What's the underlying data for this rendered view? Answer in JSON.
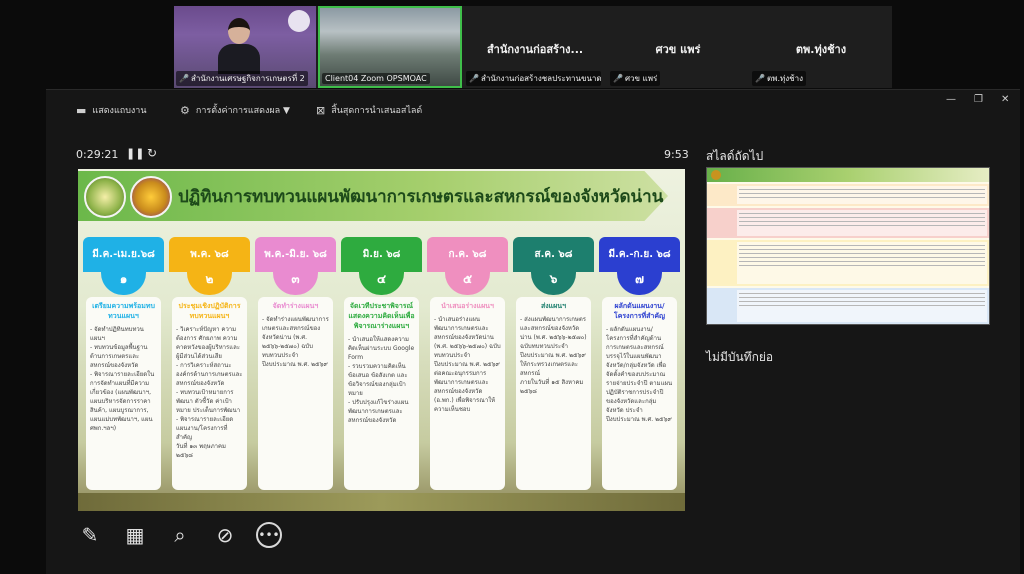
{
  "participants": [
    {
      "caption": "สำนักงานเศรษฐกิจการเกษตรที่ 2",
      "big_name": ""
    },
    {
      "caption": "Client04 Zoom OPSMOAC",
      "big_name": ""
    },
    {
      "caption": "สำนักงานก่อสร้างชลประทานขนาดกลา...",
      "big_name": "สำนักงานก่อสร้าง..."
    },
    {
      "caption": "ศวข แพร่",
      "big_name": "ศวข แพร่"
    },
    {
      "caption": "ตพ.ทุ่งช้าง",
      "big_name": "ตพ.ทุ่งช้าง"
    }
  ],
  "toolbar": {
    "show_taskbar": "แสดงแถบงาน",
    "display_settings": "การตั้งค่าการแสดงผล ▼",
    "end_slideshow": "สิ้นสุดการนำเสนอสไลด์"
  },
  "presenter": {
    "elapsed": "0:29:21",
    "clock": "9:53",
    "next_slide_label": "สไลด์ถัดไป",
    "notes_label": "ไม่มีบันทึกย่อ"
  },
  "slide": {
    "title": "ปฏิทินการทบทวนแผนพัฒนาการเกษตรและสหกรณ์ของจังหวัดน่าน",
    "steps": [
      {
        "period": "มี.ค.-เม.ย.๖๘",
        "num": "๑",
        "head_color": "#1fb1e6",
        "title": "เตรียมความพร้อมทบทวนแผนฯ",
        "body": "- จัดทำปฏิทินทบทวนแผนฯ\n- ทบทวนข้อมูลพื้นฐานด้านการเกษตรและสหกรณ์ของจังหวัด\n- พิจารณารายละเอียดในการจัดทำแผนที่มีความเกี่ยวข้อง (แผนพัฒนาฯ, แผนบริหารจัดการราคาสินค้า, แผนบูรณาการ, แผนแม่บทพัฒนาฯ, แผน ศพก.ฯลฯ)",
        "highlight": ""
      },
      {
        "period": "พ.ค. ๖๘",
        "num": "๒",
        "head_color": "#f5b415",
        "title": "ประชุมเชิงปฏิบัติการทบทวนแผนฯ",
        "body": "- วิเคราะห์ปัญหา ความต้องการ ศักยภาพ ความคาดหวังของผู้บริหารและผู้มีส่วนได้ส่วนเสีย\n- การวิเคราะห์สถานะองค์กรด้านการเกษตรและสหกรณ์ของจังหวัด\n- ทบทวนเป้าหมายการพัฒนา ตัวชี้วัด ค่าเป้าหมาย ประเด็นการพัฒนา\n- พิจารณารายละเอียดแผนงาน/โครงการที่สำคัญ",
        "highlight": "วันที่ ๑๓ พฤษภาคม ๒๕๖๘"
      },
      {
        "period": "พ.ค.-มิ.ย. ๖๘",
        "num": "๓",
        "head_color": "#e98bd0",
        "title": "จัดทำร่างแผนฯ",
        "body": "- จัดทำร่างแผนพัฒนาการเกษตรและสหกรณ์ของจังหวัดน่าน (พ.ศ. ๒๕๖๖-๒๕๗๐) ฉบับทบทวนประจำปีงบประมาณ พ.ศ. ๒๕๖๙",
        "highlight": ""
      },
      {
        "period": "มิ.ย. ๖๘",
        "num": "๔",
        "head_color": "#2eab3f",
        "title": "จัดเวทีประชาพิจารณ์แสดงความคิดเห็นเพื่อพิจารณาร่างแผนฯ",
        "body": "- นำเสนอให้แสดงความคิดเห็นผ่านระบบ Google Form\n- รวบรวมความคิดเห็น ข้อเสนอ ข้อสังเกต และข้อวิจารณ์ของกลุ่มเป้าหมาย\n- ปรับปรุงแก้ไขร่างแผนพัฒนาการเกษตรและสหกรณ์ของจังหวัด",
        "highlight": ""
      },
      {
        "period": "ก.ค. ๖๘",
        "num": "๕",
        "head_color": "#ef8fbf",
        "title": "นำเสนอร่างแผนฯ",
        "body": "- นำเสนอร่างแผนพัฒนาการเกษตรและสหกรณ์ของจังหวัดน่าน (พ.ศ. ๒๕๖๖-๒๕๗๐) ฉบับทบทวนประจำปีงบประมาณ พ.ศ. ๒๕๖๙ ต่อคณะอนุกรรมการพัฒนาการเกษตรและสหกรณ์ของจังหวัด (อ.พก.) เพื่อพิจารณาให้ความเห็นชอบ",
        "highlight": ""
      },
      {
        "period": "ส.ค. ๖๘",
        "num": "๖",
        "head_color": "#1d7f6e",
        "title": "ส่งแผนฯ",
        "body": "- ส่งแผนพัฒนาการเกษตรและสหกรณ์ของจังหวัดน่าน (พ.ศ. ๒๕๖๖-๒๕๗๐) ฉบับทบทวนประจำปีงบประมาณ พ.ศ. ๒๕๖๙ ให้กระทรวงเกษตรและสหกรณ์",
        "highlight": "ภายในวันที่ ๑๕ สิงหาคม ๒๕๖๘"
      },
      {
        "period": "มี.ค.-ก.ย. ๖๘",
        "num": "๗",
        "head_color": "#2b3fd0",
        "title": "ผลักดันแผนงาน/โครงการที่สำคัญ",
        "body": "- ผลักดันแผนงาน/โครงการที่สำคัญด้านการเกษตรและสหกรณ์ บรรจุไว้ในแผนพัฒนาจังหวัด/กลุ่มจังหวัด เพื่อจัดตั้งคำของบประมาณรายจ่ายประจำปี ตามแผนปฏิบัติราชการประจำปีของจังหวัดและกลุ่มจังหวัด ประจำปีงบประมาณ พ.ศ. ๒๕๖๙",
        "highlight": ""
      }
    ]
  },
  "tools": [
    "pen-icon",
    "slides-grid-icon",
    "zoom-icon",
    "screen-off-icon",
    "more-icon"
  ],
  "colors": {
    "active_speaker_border": "#3fbf4a",
    "muted_mic": "#e04343",
    "background": "#0b0b0b"
  }
}
